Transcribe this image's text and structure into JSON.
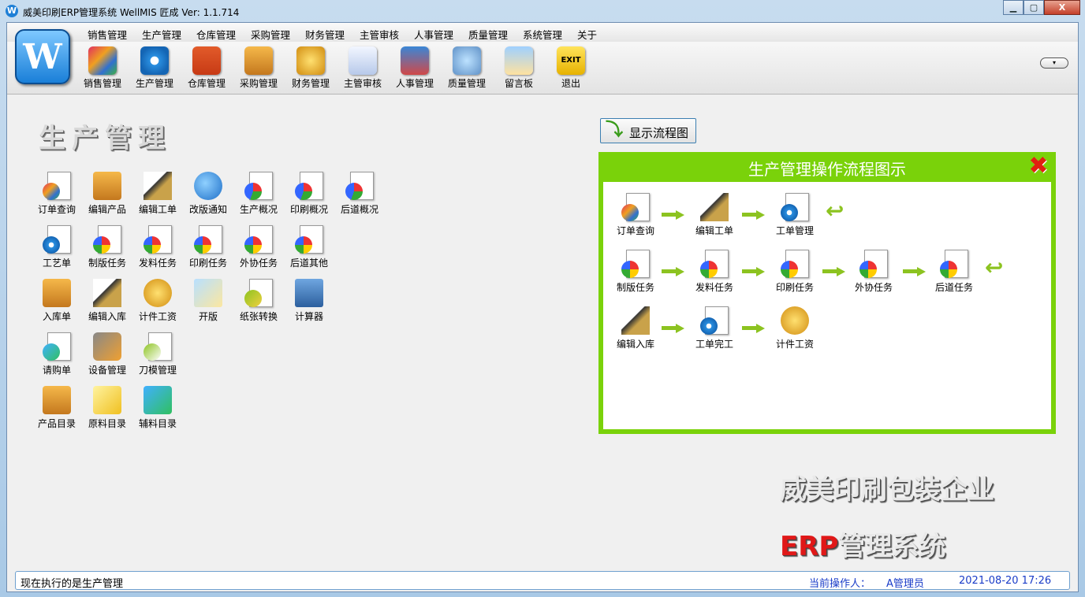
{
  "window": {
    "app_icon_letter": "W",
    "title": "威美印刷ERP管理系统  WellMIS 匠成  Ver: 1.1.714",
    "min_label": "▁",
    "max_label": "▢",
    "close_label": "X"
  },
  "menubar": {
    "items": [
      "销售管理",
      "生产管理",
      "仓库管理",
      "采购管理",
      "财务管理",
      "主管审核",
      "人事管理",
      "质量管理",
      "系统管理",
      "关于"
    ]
  },
  "logo": {
    "letter": "W"
  },
  "toolbar": {
    "items": [
      {
        "label": "销售管理",
        "icon": "sales-icon"
      },
      {
        "label": "生产管理",
        "icon": "production-gear-icon"
      },
      {
        "label": "仓库管理",
        "icon": "warehouse-icon"
      },
      {
        "label": "采购管理",
        "icon": "purchase-box-icon"
      },
      {
        "label": "财务管理",
        "icon": "finance-coin-icon"
      },
      {
        "label": "主管审核",
        "icon": "audit-check-icon"
      },
      {
        "label": "人事管理",
        "icon": "people-icon"
      },
      {
        "label": "质量管理",
        "icon": "magnifier-icon"
      },
      {
        "label": "留言板",
        "icon": "message-board-icon"
      },
      {
        "label": "退出",
        "icon": "exit-icon"
      }
    ],
    "exit_text": "EXIT",
    "collapse_glyph": "▾"
  },
  "main": {
    "section_title": "生产管理",
    "grid": [
      [
        {
          "label": "订单查询",
          "icon": "order-query-icon"
        },
        {
          "label": "编辑产品",
          "icon": "edit-product-icon"
        },
        {
          "label": "编辑工单",
          "icon": "edit-workorder-icon"
        },
        {
          "label": "改版通知",
          "icon": "revision-notice-icon"
        },
        {
          "label": "生产概况",
          "icon": "production-overview-icon"
        },
        {
          "label": "印刷概况",
          "icon": "print-overview-icon"
        },
        {
          "label": "后道概况",
          "icon": "postpress-overview-icon"
        }
      ],
      [
        {
          "label": "工艺单",
          "icon": "process-sheet-icon"
        },
        {
          "label": "制版任务",
          "icon": "plate-task-icon"
        },
        {
          "label": "发料任务",
          "icon": "material-issue-icon"
        },
        {
          "label": "印刷任务",
          "icon": "print-task-icon"
        },
        {
          "label": "外协任务",
          "icon": "outsource-task-icon"
        },
        {
          "label": "后道其他",
          "icon": "postpress-other-icon"
        }
      ],
      [
        {
          "label": "入库单",
          "icon": "stock-in-icon"
        },
        {
          "label": "编辑入库",
          "icon": "edit-stock-in-icon"
        },
        {
          "label": "计件工资",
          "icon": "piece-wage-icon"
        },
        {
          "label": "开版",
          "icon": "open-plate-icon"
        },
        {
          "label": "纸张转换",
          "icon": "paper-convert-icon"
        },
        {
          "label": "计算器",
          "icon": "calculator-icon"
        }
      ],
      [
        {
          "label": "请购单",
          "icon": "purchase-request-icon"
        },
        {
          "label": "设备管理",
          "icon": "equipment-icon"
        },
        {
          "label": "刀模管理",
          "icon": "die-cut-icon"
        }
      ],
      [
        {
          "label": "产品目录",
          "icon": "product-catalog-icon"
        },
        {
          "label": "原料目录",
          "icon": "raw-material-icon"
        },
        {
          "label": "辅料目录",
          "icon": "auxiliary-material-icon"
        }
      ]
    ],
    "show_flow_button": "显示流程图"
  },
  "flow": {
    "title": "生产管理操作流程图示",
    "close_glyph": "✖",
    "loop_glyph": "↩",
    "rows": [
      [
        "订单查询",
        "编辑工单",
        "工单管理"
      ],
      [
        "制版任务",
        "发料任务",
        "印刷任务",
        "外协任务",
        "后道任务"
      ],
      [
        "编辑入库",
        "工单完工",
        "计件工资"
      ]
    ]
  },
  "branding": {
    "line1": "威美印刷包装企业",
    "line2_red": "ERP",
    "line2_rest": "管理系统"
  },
  "statusbar": {
    "current": "现在执行的是生产管理",
    "operator_label": "当前操作人：",
    "operator": "A管理员",
    "datetime": "2021-08-20 17:26"
  }
}
